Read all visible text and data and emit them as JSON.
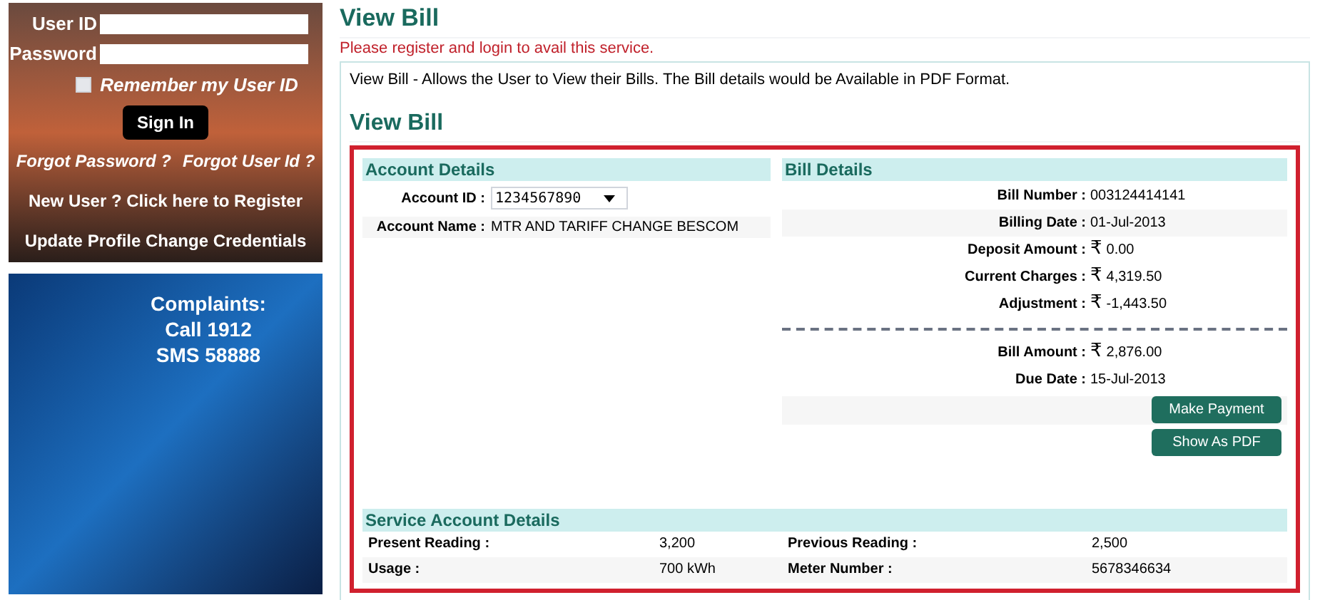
{
  "login": {
    "fields": [
      {
        "label": "User ID"
      },
      {
        "label": "Password"
      }
    ],
    "remember": {
      "label": "Remember my User ID",
      "checked": false
    },
    "sign_in": "Sign In",
    "links": [
      "Forgot Password ?",
      "Forgot User Id ?"
    ],
    "register": "New User ?  Click here to Register",
    "update": "Update Profile Change Credentials"
  },
  "banner": {
    "lines": [
      "Complaints:",
      "Call 1912",
      "SMS 58888"
    ]
  },
  "page": {
    "title": "View Bill",
    "notice": "Please register and login to avail this service.",
    "description": "View Bill - Allows the User to View their Bills. The Bill details would be Available in PDF Format.",
    "subtitle": "View Bill"
  },
  "account_details": {
    "heading": "Account Details",
    "account_id_label": "Account ID :",
    "account_id": "1234567890",
    "account_name_label": "Account Name :",
    "account_name": "MTR AND TARIFF CHANGE BESCOM"
  },
  "bill_details": {
    "heading": "Bill Details",
    "rows": [
      {
        "label": "Bill Number :",
        "value": "003124414141"
      },
      {
        "label": "Billing Date :",
        "value": "01-Jul-2013"
      },
      {
        "label": "Deposit Amount :",
        "currency": "₹",
        "value": "0.00"
      },
      {
        "label": "Current Charges :",
        "currency": "₹",
        "value": "4,319.50"
      },
      {
        "label": "Adjustment :",
        "currency": "₹",
        "value": "-1,443.50"
      }
    ],
    "totals": [
      {
        "label": "Bill Amount :",
        "currency": "₹",
        "value": "2,876.00"
      },
      {
        "label": "Due Date :",
        "value": "15-Jul-2013"
      }
    ],
    "buttons": [
      "Make Payment",
      "Show As PDF"
    ]
  },
  "service_account": {
    "heading": "Service Account Details",
    "rows": [
      [
        {
          "label": "Present Reading :",
          "value": "3,200"
        },
        {
          "label": "Previous Reading :",
          "value": "2,500"
        }
      ],
      [
        {
          "label": "Usage :",
          "value": "700 kWh"
        },
        {
          "label": "Meter Number :",
          "value": "5678346634"
        }
      ]
    ]
  }
}
